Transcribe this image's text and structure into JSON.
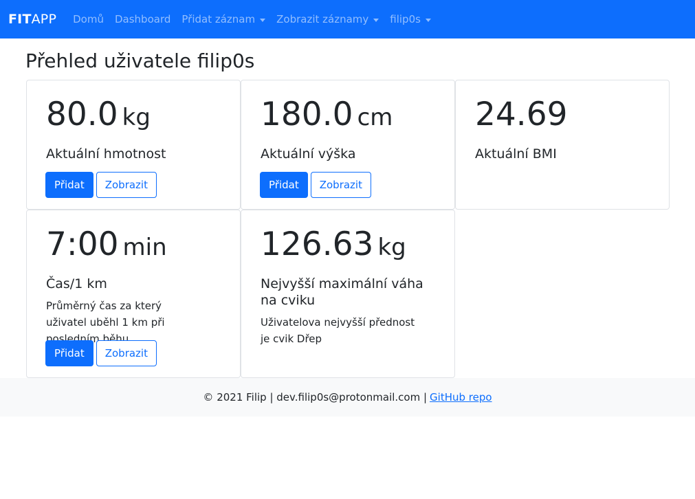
{
  "navbar": {
    "brand_bold": "FIT",
    "brand_rest": "APP",
    "items": [
      {
        "label": "Domů",
        "dropdown": false
      },
      {
        "label": "Dashboard",
        "dropdown": false
      },
      {
        "label": "Přidat záznam",
        "dropdown": true
      },
      {
        "label": "Zobrazit záznamy",
        "dropdown": true
      },
      {
        "label": "filip0s",
        "dropdown": true
      }
    ]
  },
  "page": {
    "title": "Přehled uživatele filip0s"
  },
  "cards": {
    "weight": {
      "value": "80.0",
      "unit": "kg",
      "label": "Aktuální hmotnost",
      "add": "Přidat",
      "show": "Zobrazit"
    },
    "height": {
      "value": "180.0",
      "unit": "cm",
      "label": "Aktuální výška",
      "add": "Přidat",
      "show": "Zobrazit"
    },
    "bmi": {
      "value": "24.69",
      "label": "Aktuální BMI"
    },
    "run": {
      "value": "7:00",
      "unit": "min",
      "label": "Čas/1 km",
      "desc": "Průměrný čas za který uživatel uběhl 1 km při posledním běhu",
      "add": "Přidat",
      "show": "Zobrazit"
    },
    "maxweight": {
      "value": "126.63",
      "unit": "kg",
      "label": "Nejvyšší maximální váha na cviku",
      "desc": "Uživatelova nejvyšší přednost je cvik Dřep"
    }
  },
  "footer": {
    "text": "© 2021 Filip | dev.filip0s@protonmail.com |",
    "link": "GitHub repo"
  },
  "colors": {
    "primary": "#0d6efd",
    "footer_bg": "#f8f9fa",
    "border": "#dfe2e6"
  }
}
